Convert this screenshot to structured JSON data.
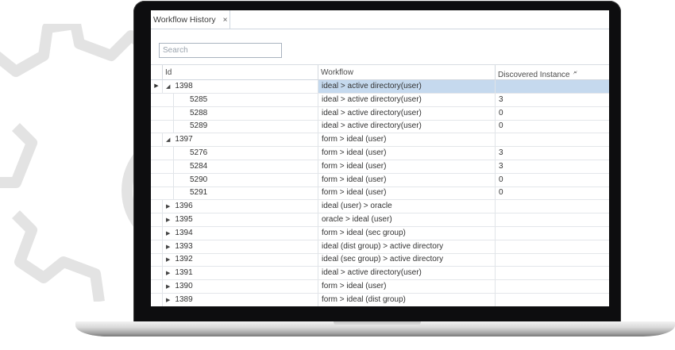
{
  "window": {
    "tab_title": "Workflow History",
    "tab_close_glyph": "×"
  },
  "search": {
    "placeholder": "Search"
  },
  "grid": {
    "columns": [
      "Id",
      "Workflow",
      "Discovered Instance"
    ],
    "rows": [
      {
        "id": "1398",
        "workflow": "ideal > active directory(user)",
        "discovered": "",
        "level": 0,
        "expanded": true,
        "selected": true
      },
      {
        "id": "5285",
        "workflow": "ideal > active directory(user)",
        "discovered": "3",
        "level": 1
      },
      {
        "id": "5288",
        "workflow": "ideal > active directory(user)",
        "discovered": "0",
        "level": 1
      },
      {
        "id": "5289",
        "workflow": "ideal > active directory(user)",
        "discovered": "0",
        "level": 1
      },
      {
        "id": "1397",
        "workflow": "form > ideal (user)",
        "discovered": "",
        "level": 0,
        "expanded": true
      },
      {
        "id": "5276",
        "workflow": "form > ideal (user)",
        "discovered": "3",
        "level": 1
      },
      {
        "id": "5284",
        "workflow": "form > ideal (user)",
        "discovered": "3",
        "level": 1
      },
      {
        "id": "5290",
        "workflow": "form > ideal (user)",
        "discovered": "0",
        "level": 1
      },
      {
        "id": "5291",
        "workflow": "form > ideal (user)",
        "discovered": "0",
        "level": 1
      },
      {
        "id": "1396",
        "workflow": "ideal (user) > oracle",
        "discovered": "",
        "level": 0,
        "expanded": false
      },
      {
        "id": "1395",
        "workflow": "oracle > ideal (user)",
        "discovered": "",
        "level": 0,
        "expanded": false
      },
      {
        "id": "1394",
        "workflow": "form > ideal (sec group)",
        "discovered": "",
        "level": 0,
        "expanded": false
      },
      {
        "id": "1393",
        "workflow": "ideal (dist group) > active directory",
        "discovered": "",
        "level": 0,
        "expanded": false
      },
      {
        "id": "1392",
        "workflow": "ideal (sec group) > active directory",
        "discovered": "",
        "level": 0,
        "expanded": false
      },
      {
        "id": "1391",
        "workflow": "ideal > active directory(user)",
        "discovered": "",
        "level": 0,
        "expanded": false
      },
      {
        "id": "1390",
        "workflow": "form > ideal (user)",
        "discovered": "",
        "level": 0,
        "expanded": false
      },
      {
        "id": "1389",
        "workflow": "form > ideal (dist group)",
        "discovered": "",
        "level": 0,
        "expanded": false
      }
    ]
  },
  "icons": {
    "expanded": "◢",
    "collapsed": "▶",
    "row_indicator": "▶",
    "filter": "funnel-icon"
  },
  "colors": {
    "selection": "#c5d9ee",
    "gear": "#e2e2e2",
    "bezel": "#0d0d0f"
  }
}
